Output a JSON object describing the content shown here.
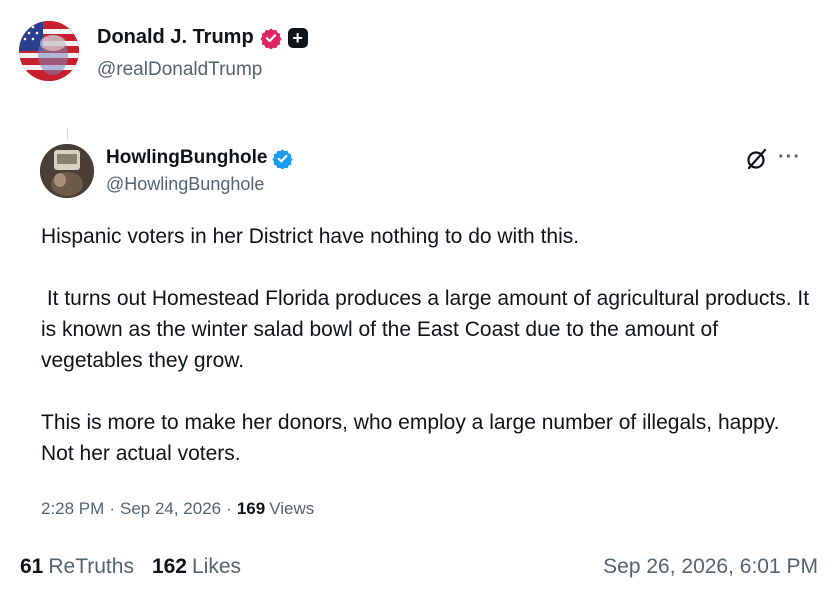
{
  "author": {
    "name": "Donald J. Trump",
    "handle": "@realDonaldTrump",
    "verified_badge_color": "#e0245e",
    "plus_badge_symbol": "+"
  },
  "quoted": {
    "name": "HowlingBunghole",
    "handle": "@HowlingBunghole",
    "verified_badge_color": "#1d9bf0",
    "paragraphs": [
      "Hispanic voters in her District have nothing to do with this.",
      " It turns out Homestead Florida produces a large amount of agricultural products. It is known as the winter salad bowl of the East Coast due to the amount of vegetables they grow.",
      "This is more to make her donors, who employ a large number of illegals, happy. Not her actual voters."
    ],
    "time": "2:28 PM",
    "date": "Sep 24, 2026",
    "separator": "·",
    "views_count": "169",
    "views_label": "Views",
    "more_icon": "···"
  },
  "stats": {
    "retruths_count": "61",
    "retruths_label": "ReTruths",
    "likes_count": "162",
    "likes_label": "Likes",
    "posted_at": "Sep 26, 2026, 6:01 PM"
  },
  "colors": {
    "text": "#0f1419",
    "muted": "#536471",
    "verified_blue": "#1d9bf0",
    "verified_pink": "#e0245e"
  }
}
